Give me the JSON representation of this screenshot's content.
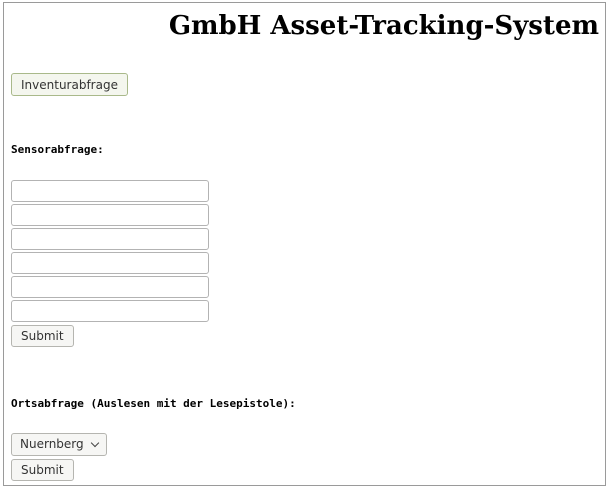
{
  "header": {
    "title": "GmbH Asset-Tracking-System"
  },
  "inventory": {
    "button_label": "Inventurabfrage"
  },
  "sensor_query": {
    "label": "Sensorabfrage:",
    "fields": [
      "",
      "",
      "",
      "",
      "",
      ""
    ],
    "submit_label": "Submit"
  },
  "location_query": {
    "label": "Ortsabfrage (Auslesen mit der Lesepistole):",
    "selected_value": "Nuernberg",
    "submit_label": "Submit"
  }
}
